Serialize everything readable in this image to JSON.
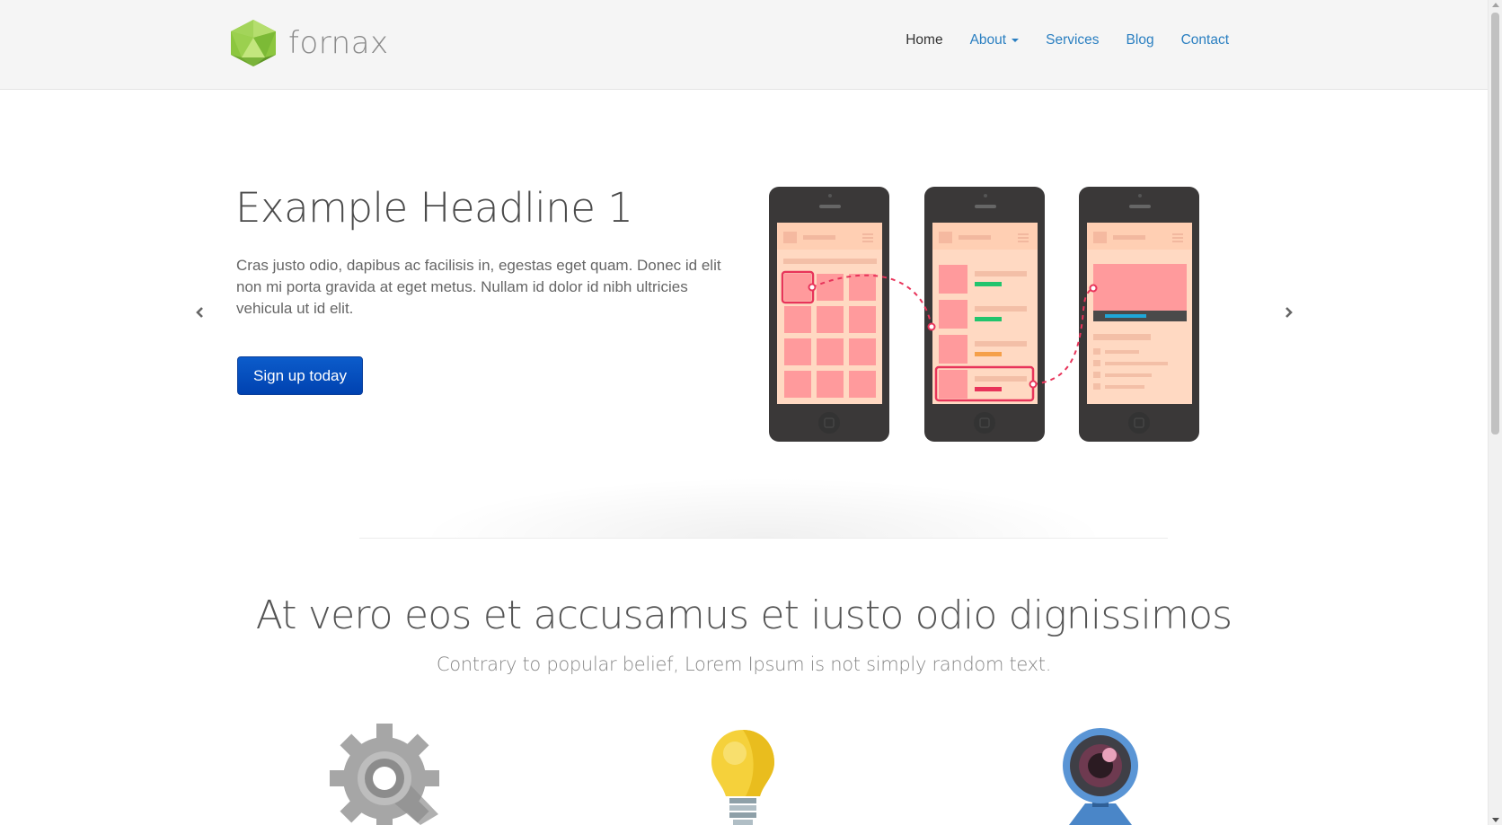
{
  "brand": {
    "name": "fornax",
    "logo_icon": "green-hexagon-logo-icon"
  },
  "nav": {
    "items": [
      {
        "label": "Home",
        "active": true
      },
      {
        "label": "About",
        "dropdown": true
      },
      {
        "label": "Services"
      },
      {
        "label": "Blog"
      },
      {
        "label": "Contact"
      }
    ]
  },
  "hero": {
    "headline": "Example Headline 1",
    "body": "Cras justo odio, dapibus ac facilisis in, egestas eget quam. Donec id elit non mi porta gravida at eget metus. Nullam id dolor id nibh ultricies vehicula ut id elit.",
    "cta_label": "Sign up today",
    "illustration": "three-phones-app-flow-illustration",
    "prev_icon": "chevron-left-icon",
    "next_icon": "chevron-right-icon"
  },
  "features": {
    "title": "At vero eos et accusamus et iusto odio dignissimos",
    "subtitle": "Contrary to popular belief, Lorem Ipsum is not simply random text.",
    "icons": [
      "gear-icon",
      "lightbulb-icon",
      "webcam-icon"
    ]
  },
  "colors": {
    "accent": "#2a7fc1",
    "cta": "#0052c0",
    "navbar_bg": "#f5f5f5",
    "logo_green": "#8cc63f",
    "phone_screen": "#ffdcc4",
    "phone_tile": "#ff9a9c",
    "flow_line": "#e8345a"
  }
}
